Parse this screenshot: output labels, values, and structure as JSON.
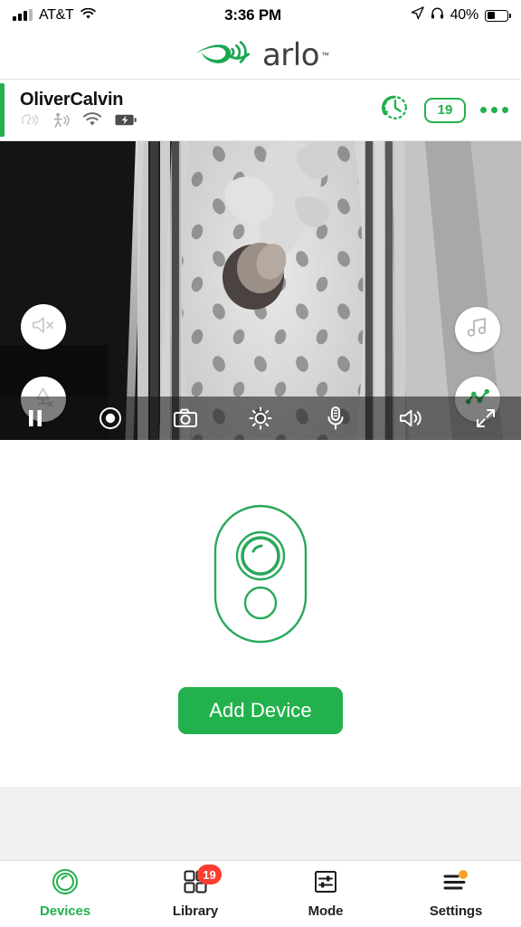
{
  "status_bar": {
    "carrier": "AT&T",
    "time": "3:36 PM",
    "battery_percent": "40%",
    "battery_level": 40,
    "icons": [
      "signal-bars-icon",
      "wifi-icon",
      "location-arrow-icon",
      "headphones-icon",
      "battery-icon"
    ]
  },
  "brand": {
    "name": "arlo",
    "trademark": "™",
    "logo_color": "#22a94f",
    "text_color": "#3f3f3f"
  },
  "camera_header": {
    "name": "OliverCalvin",
    "accent_color": "#22b14c",
    "status_icons": [
      "audio-detection-icon",
      "motion-detection-icon",
      "wifi-icon",
      "battery-charging-icon"
    ],
    "history_icon": "clock-history-icon",
    "badge_count": "19",
    "menu_icon": "more-options-icon"
  },
  "video": {
    "overlay_buttons": [
      {
        "name": "speaker-mute-icon",
        "state": "muted"
      },
      {
        "name": "nightlight-off-icon",
        "state": "off"
      },
      {
        "name": "music-icon",
        "state": "available"
      },
      {
        "name": "activity-chart-icon",
        "state": "active",
        "color": "#22b14c"
      }
    ],
    "toolbar_buttons": [
      "pause-icon",
      "record-icon",
      "snapshot-icon",
      "brightness-icon",
      "microphone-icon",
      "volume-icon",
      "fullscreen-icon"
    ]
  },
  "add_device": {
    "illustration": "camera-outline-icon",
    "illustration_color": "#22b14c",
    "button_label": "Add Device",
    "button_color": "#23b14d"
  },
  "tabbar": {
    "items": [
      {
        "label": "Devices",
        "icon": "camera-lens-icon",
        "active": true,
        "badge": ""
      },
      {
        "label": "Library",
        "icon": "grid-icon",
        "active": false,
        "badge": "19"
      },
      {
        "label": "Mode",
        "icon": "sliders-icon",
        "active": false,
        "badge": ""
      },
      {
        "label": "Settings",
        "icon": "hamburger-icon",
        "active": false,
        "badge": "",
        "dot": true
      }
    ],
    "badge_color": "#fc3d2f",
    "dot_color": "#f5a623",
    "active_color": "#22b14c"
  }
}
